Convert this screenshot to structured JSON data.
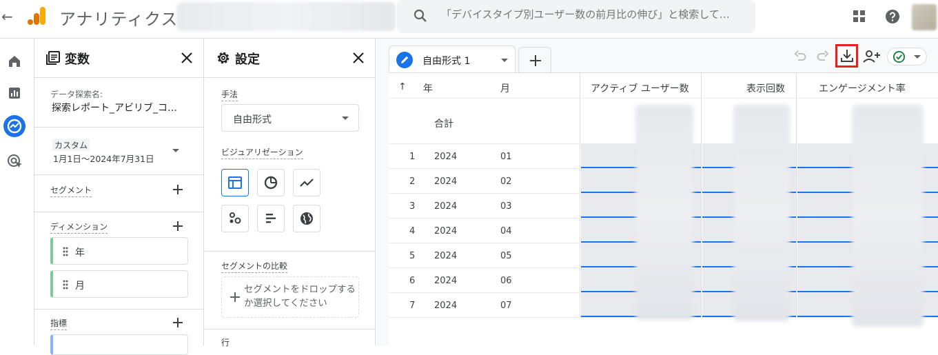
{
  "header": {
    "back_label": "←",
    "app_title": "アナリティクス",
    "search_placeholder": "「デバイスタイプ別ユーザー数の前月比の伸び」と検索して…"
  },
  "variables_panel": {
    "title": "変数",
    "exploration_label": "データ探索名:",
    "exploration_name": "探索レポート_アビリブ_コ…",
    "date_range_tag": "カスタム",
    "date_range_value": "1月1日～2024年7月31日",
    "segments_label": "セグメント",
    "dimensions_label": "ディメンション",
    "dimensions": [
      "年",
      "月"
    ],
    "metrics_label": "指標"
  },
  "settings_panel": {
    "title": "設定",
    "technique_label": "手法",
    "technique_value": "自由形式",
    "visualization_label": "ビジュアリゼーション",
    "segment_compare_label": "セグメントの比較",
    "drop_zone_text": "セグメントをドロップするか選択してください",
    "rows_label": "行"
  },
  "main": {
    "tab_label": "自由形式 1",
    "table": {
      "sort_indicator": "↑",
      "headers": {
        "year": "年",
        "month": "月",
        "active_users": "アクティブ ユーザー数",
        "views": "表示回数",
        "engagement_rate": "エンゲージメント率"
      },
      "total_label": "合計",
      "rows": [
        {
          "index": "1",
          "year": "2024",
          "month": "01"
        },
        {
          "index": "2",
          "year": "2024",
          "month": "02"
        },
        {
          "index": "3",
          "year": "2024",
          "month": "03"
        },
        {
          "index": "4",
          "year": "2024",
          "month": "04"
        },
        {
          "index": "5",
          "year": "2024",
          "month": "05"
        },
        {
          "index": "6",
          "year": "2024",
          "month": "06"
        },
        {
          "index": "7",
          "year": "2024",
          "month": "07"
        }
      ]
    }
  },
  "colors": {
    "accent": "#1a73e8",
    "highlight_box": "#e8221b",
    "analytics_orange": "#f9ab00",
    "analytics_dark_orange": "#e37400",
    "status_green": "#188038"
  }
}
